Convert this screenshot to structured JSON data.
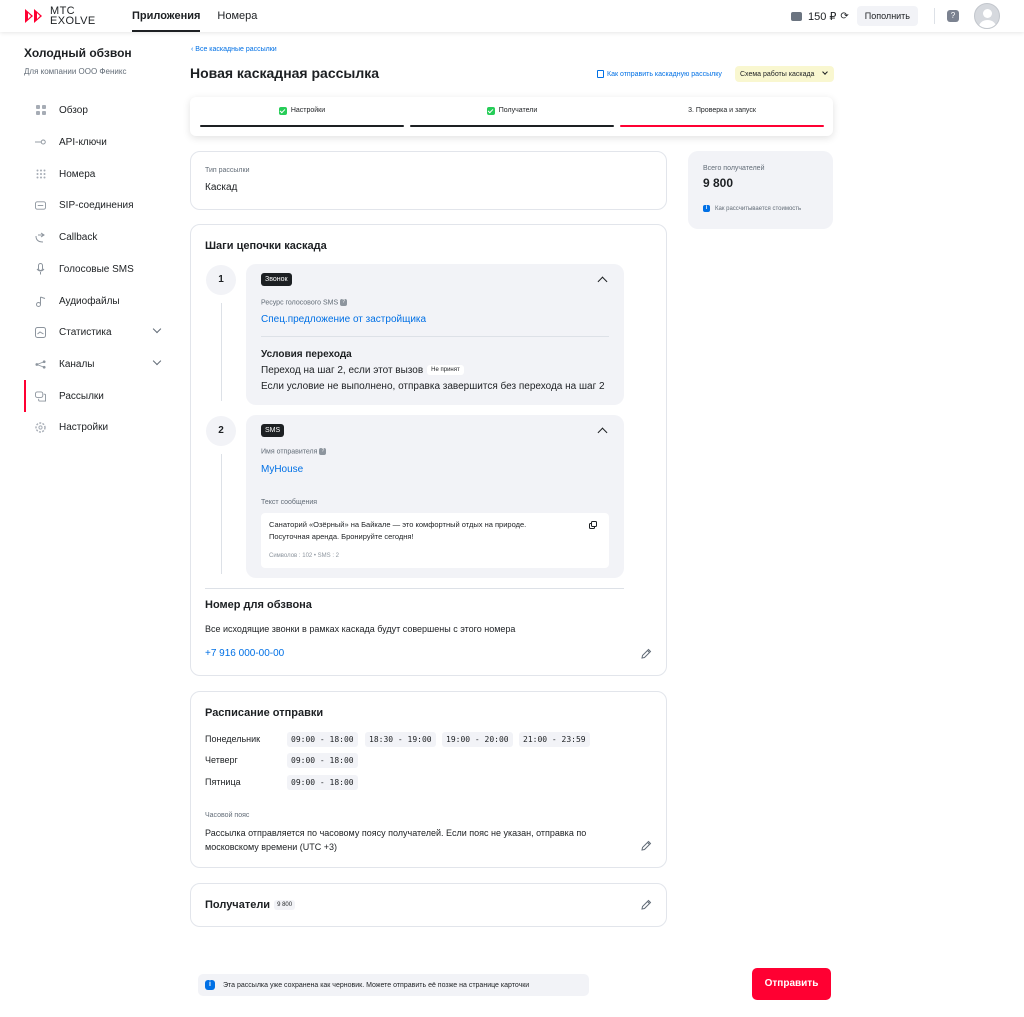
{
  "topbar": {
    "brand_line1": "МТС",
    "brand_line2": "EXOLVE",
    "nav": [
      {
        "label": "Приложения",
        "active": true
      },
      {
        "label": "Номера",
        "active": false
      }
    ],
    "balance": "150 ₽",
    "topup_label": "Пополнить"
  },
  "sidebar": {
    "title": "Холодный обзвон",
    "subtitle": "Для компании ООО Феникс",
    "items": [
      {
        "label": "Обзор",
        "icon": "grid-icon"
      },
      {
        "label": "API-ключи",
        "icon": "key-icon"
      },
      {
        "label": "Номера",
        "icon": "dialpad-icon"
      },
      {
        "label": "SIP-соединения",
        "icon": "sip-icon"
      },
      {
        "label": "Callback",
        "icon": "callback-icon"
      },
      {
        "label": "Голосовые SMS",
        "icon": "microphone-icon"
      },
      {
        "label": "Аудиофайлы",
        "icon": "music-note-icon"
      },
      {
        "label": "Статистика",
        "icon": "chart-icon"
      },
      {
        "label": "Каналы",
        "icon": "share-icon"
      },
      {
        "label": "Рассылки",
        "icon": "chat-icon"
      },
      {
        "label": "Настройки",
        "icon": "gear-icon"
      }
    ]
  },
  "header": {
    "breadcrumb": "Все каскадные рассылки",
    "title": "Новая каскадная рассылка",
    "howto_link": "Как отправить каскадную рассылку",
    "scheme_button": "Схема работы каскада"
  },
  "stepper": {
    "steps": [
      {
        "label": "Настройки",
        "done": true
      },
      {
        "label": "Получатели",
        "done": true
      },
      {
        "label": "3.  Проверка и запуск",
        "done": false
      }
    ]
  },
  "type_card": {
    "label": "Тип рассылки",
    "value": "Каскад"
  },
  "summary": {
    "label": "Всего получателей",
    "value": "9 800",
    "cost_link": "Как рассчитывается стоимость"
  },
  "chain": {
    "title": "Шаги цепочки каскада",
    "step1": {
      "number": "1",
      "tag": "Звонок",
      "resource_label": "Ресурс голосового SMS",
      "resource_value": "Спец.предложение от застройщика",
      "conditions_title": "Условия перехода",
      "condition_text": "Переход на шаг 2, если этот вызов",
      "condition_pill": "Не принят",
      "fallback_text": "Если условие не выполнено, отправка завершится без перехода на шаг 2"
    },
    "step2": {
      "number": "2",
      "tag": "SMS",
      "sender_label": "Имя отправителя",
      "sender_value": "MyHouse",
      "message_label": "Текст сообщения",
      "message_line1": "Санаторий «Озёрный» на Байкале — это комфортный отдых на природе.",
      "message_line2": "Посуточная аренда. Бронируйте сегодня!",
      "message_stats": "Символов : 102  •  SMS : 2"
    },
    "number_title": "Номер для обзвона",
    "number_desc": "Все исходящие звонки в рамках каскада будут совершены с этого номера",
    "number_value": "+7 916 000-00-00"
  },
  "schedule": {
    "title": "Расписание отправки",
    "rows": [
      {
        "day": "Понедельник",
        "slots": [
          "09:00 - 18:00",
          "18:30 - 19:00",
          "19:00 - 20:00",
          "21:00 - 23:59"
        ]
      },
      {
        "day": "Четверг",
        "slots": [
          "09:00 - 18:00"
        ]
      },
      {
        "day": "Пятница",
        "slots": [
          "09:00 - 18:00"
        ]
      }
    ],
    "tz_label": "Часовой пояс",
    "tz_line1": "Рассылка отправляется по часовому поясу получателей. Если пояс не указан, отправка по",
    "tz_line2": "московскому времени (UTC +3)"
  },
  "recipients": {
    "title": "Получатели",
    "count": "9 800"
  },
  "footer": {
    "draft_note": "Эта рассылка уже сохранена как черновик. Можете отправить её позже на странице карточки",
    "send_label": "Отправить"
  },
  "colors": {
    "accent": "#ff0032",
    "link": "#0070e5",
    "success": "#26cd58",
    "surface": "#f2f3f7"
  }
}
